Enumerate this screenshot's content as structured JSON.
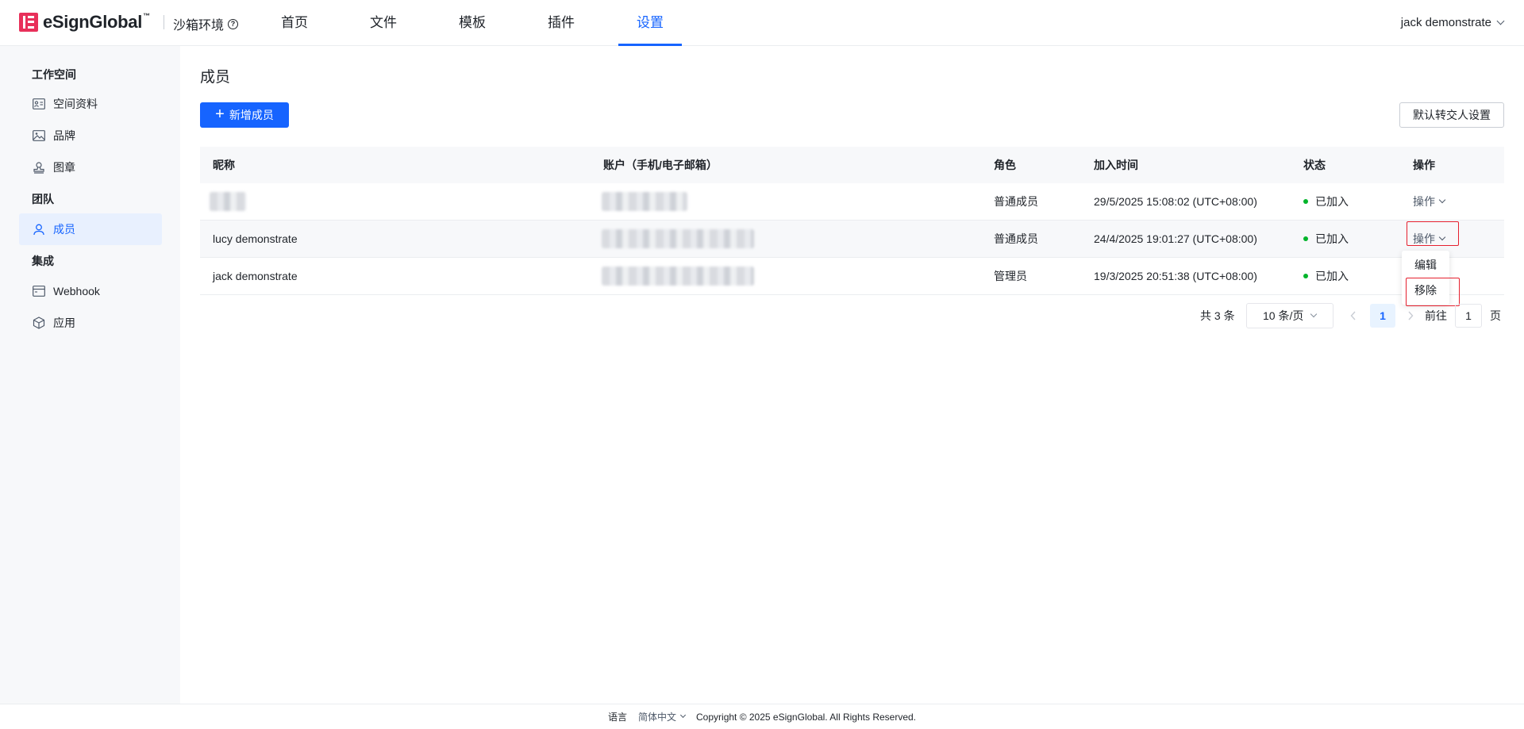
{
  "header": {
    "logo_text": "eSignGlobal",
    "logo_tm": "™",
    "sandbox": "沙箱环境",
    "nav": [
      {
        "label": "首页"
      },
      {
        "label": "文件"
      },
      {
        "label": "模板"
      },
      {
        "label": "插件"
      },
      {
        "label": "设置",
        "active": true
      }
    ],
    "user": "jack demonstrate"
  },
  "sidebar": {
    "groups": [
      {
        "label": "工作空间",
        "items": [
          {
            "label": "空间资料",
            "icon": "id-card-icon"
          },
          {
            "label": "品牌",
            "icon": "image-icon"
          },
          {
            "label": "图章",
            "icon": "stamp-icon"
          }
        ]
      },
      {
        "label": "团队",
        "items": [
          {
            "label": "成员",
            "icon": "user-icon",
            "active": true
          }
        ]
      },
      {
        "label": "集成",
        "items": [
          {
            "label": "Webhook",
            "icon": "browser-window-icon"
          },
          {
            "label": "应用",
            "icon": "cube-icon"
          }
        ]
      }
    ]
  },
  "main": {
    "title": "成员",
    "add_button": "新增成员",
    "transfer_button": "默认转交人设置",
    "table": {
      "headers": [
        "昵称",
        "账户（手机/电子邮箱）",
        "角色",
        "加入时间",
        "状态",
        "操作"
      ],
      "rows": [
        {
          "nickname": "",
          "account": "",
          "role": "普通成员",
          "joined": "29/5/2025 15:08:02 (UTC+08:00)",
          "status": "已加入",
          "action": "操作"
        },
        {
          "nickname": "lucy demonstrate",
          "account": "",
          "role": "普通成员",
          "joined": "24/4/2025 19:01:27 (UTC+08:00)",
          "status": "已加入",
          "action": "操作"
        },
        {
          "nickname": "jack demonstrate",
          "account": "",
          "role": "管理员",
          "joined": "19/3/2025 20:51:38 (UTC+08:00)",
          "status": "已加入",
          "action": "操作"
        }
      ]
    },
    "dropdown": {
      "items": [
        "编辑",
        "移除"
      ]
    },
    "pagination": {
      "total": "共 3 条",
      "page_size": "10 条/页",
      "current": "1",
      "goto_label": "前往",
      "goto_value": "1",
      "unit": "页"
    }
  },
  "footer": {
    "lang_label": "语言",
    "lang_value": "简体中文",
    "copyright": "Copyright © 2025 eSignGlobal. All Rights Reserved."
  },
  "colors": {
    "primary": "#1664ff",
    "brand": "#e8305a",
    "success": "#00b42a",
    "highlight": "#e5202e"
  }
}
